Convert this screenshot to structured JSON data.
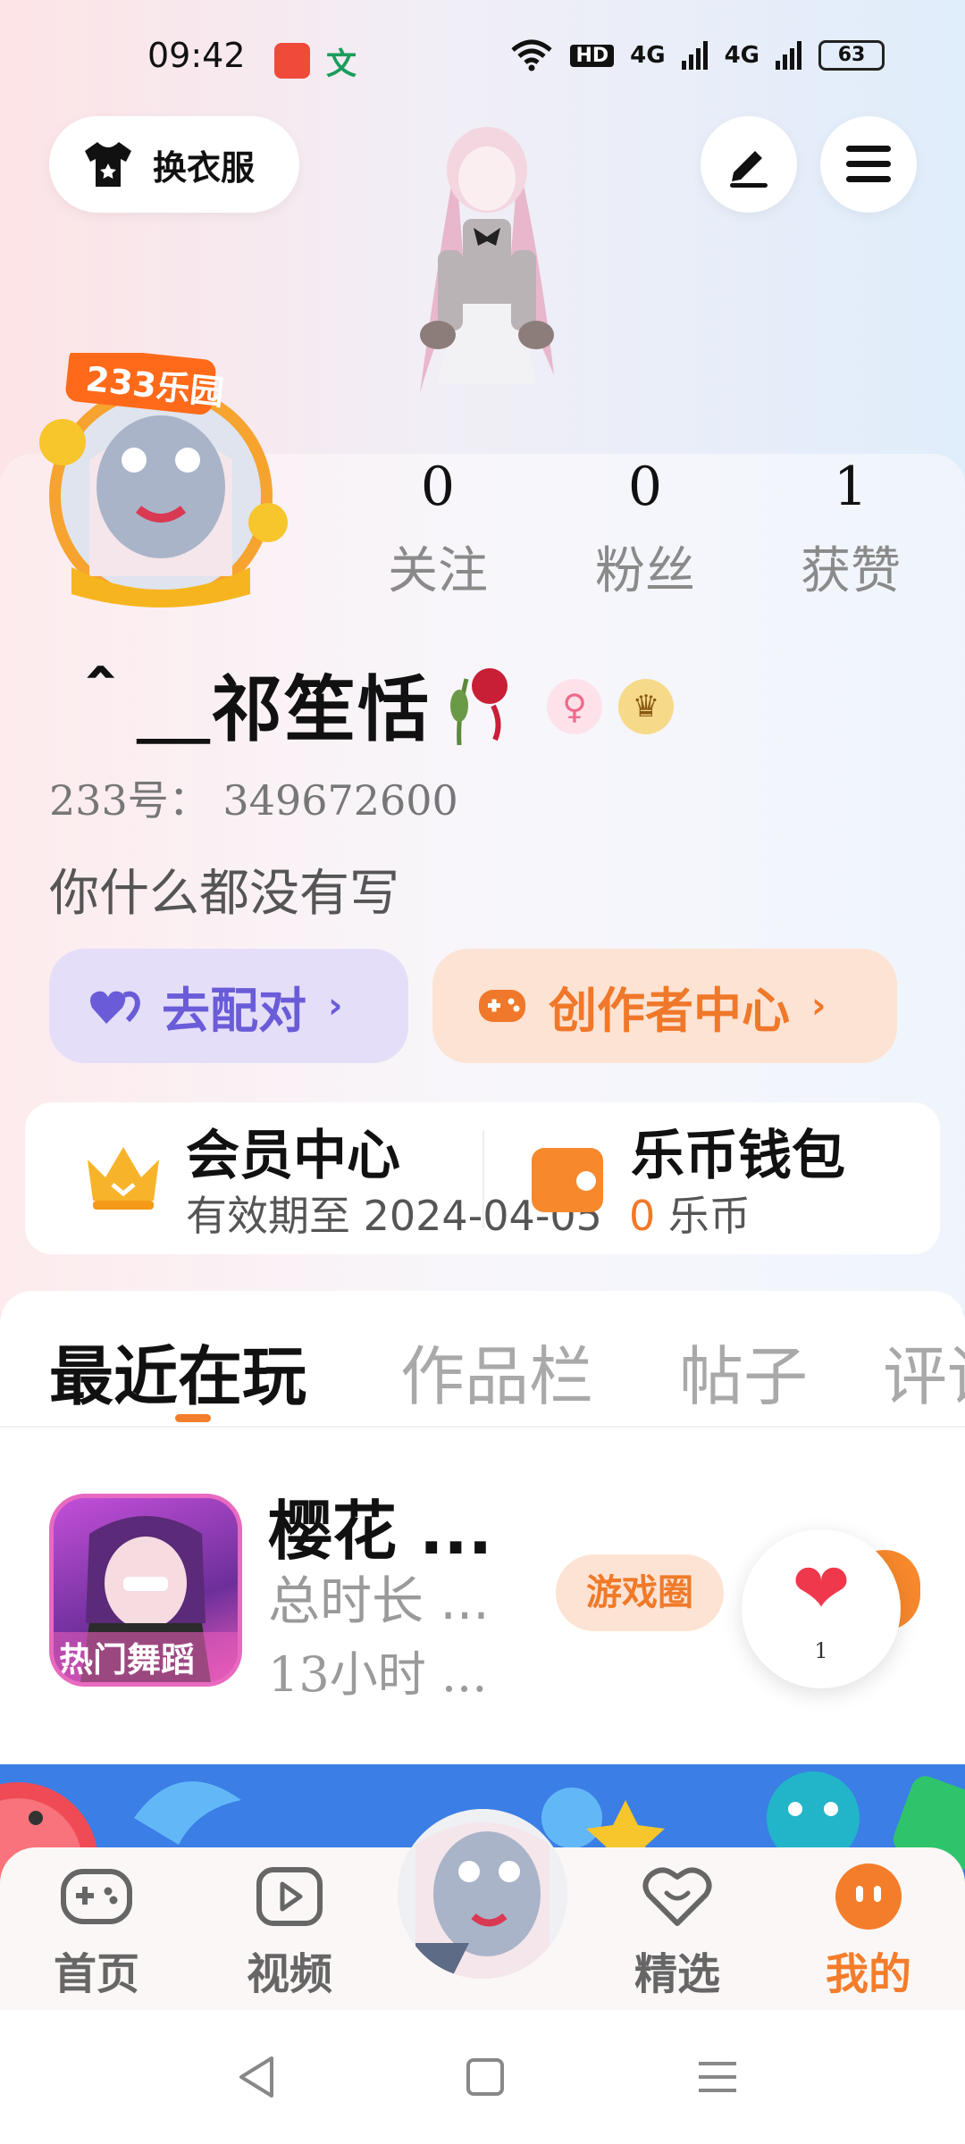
{
  "status_bar": {
    "time": "09:42",
    "app_icon_2": "文",
    "network_1": "4G",
    "network_2": "4G",
    "hd_label": "HD",
    "battery": "63"
  },
  "top": {
    "outfit_label": "换衣服"
  },
  "stats": [
    {
      "value": "0",
      "label": "关注"
    },
    {
      "value": "0",
      "label": "粉丝"
    },
    {
      "value": "1",
      "label": "获赞"
    }
  ],
  "profile": {
    "badge_text": "233乐园",
    "nickname": "＾＿祁笙恬",
    "uid": "233号： 349672600",
    "bio": "你什么都没有写"
  },
  "actions": {
    "pair_label": "去配对",
    "creator_label": "创作者中心",
    "chevron": "›"
  },
  "member": {
    "title": "会员中心",
    "subtitle": "有效期至 2024-04-05",
    "wallet_title": "乐币钱包",
    "wallet_amount": "0",
    "wallet_unit": " 乐币"
  },
  "tabs": [
    {
      "label": "最近在玩",
      "active": true
    },
    {
      "label": "作品栏",
      "active": false
    },
    {
      "label": "帖子",
      "active": false
    },
    {
      "label": "评论",
      "active": false
    }
  ],
  "recent_game": {
    "name": "樱花 ...",
    "icon_caption": "热门舞蹈",
    "total_time": "总时长 ...",
    "hours": "13小时 ...",
    "circle_button": "游戏圈",
    "like_count": "1"
  },
  "bottom_nav": [
    {
      "label": "首页",
      "icon": "gamepad-icon",
      "active": false
    },
    {
      "label": "视频",
      "icon": "video-icon",
      "active": false
    },
    {
      "label": "精选",
      "icon": "heart-badge-icon",
      "active": false
    },
    {
      "label": "我的",
      "icon": "smile-face-icon",
      "active": true
    }
  ],
  "colors": {
    "accent_orange": "#f47d2b",
    "pair_purple": "#6a5cd8"
  }
}
